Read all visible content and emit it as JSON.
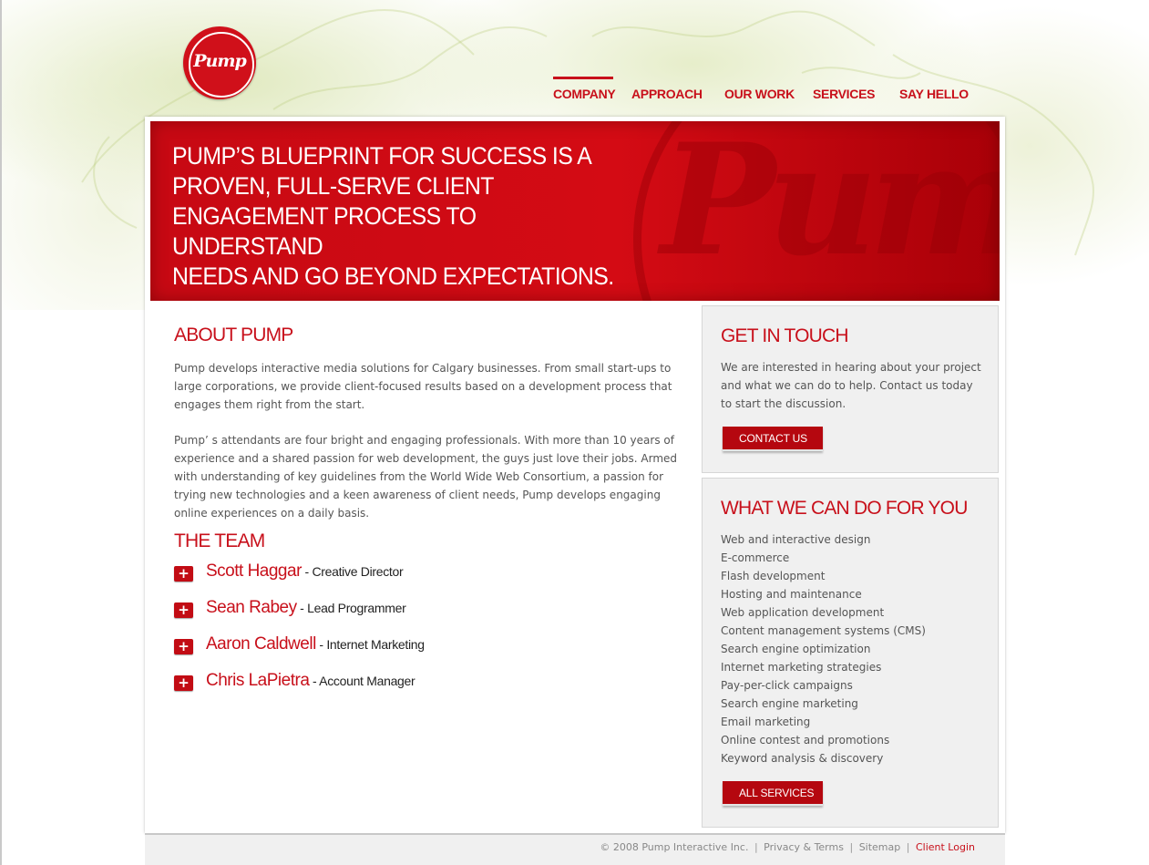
{
  "logo": {
    "text": "Pump"
  },
  "nav": {
    "items": [
      {
        "label": "COMPANY",
        "active": true
      },
      {
        "label": "APPROACH",
        "active": false
      },
      {
        "label": "OUR WORK",
        "active": false
      },
      {
        "label": "SERVICES",
        "active": false
      },
      {
        "label": "SAY HELLO",
        "active": false
      }
    ]
  },
  "hero": {
    "line1": "PUMP’S BLUEPRINT FOR SUCCESS IS A",
    "line2": "PROVEN, FULL-SERVE CLIENT",
    "line3": "ENGAGEMENT PROCESS TO UNDERSTAND",
    "line4": "NEEDS AND GO BEYOND EXPECTATIONS.",
    "watermark": "Pump"
  },
  "about": {
    "title": "ABOUT PUMP",
    "paragraph1": "Pump develops interactive media solutions for Calgary businesses. From small start-ups to large corporations, we provide client-focused results based on a development process that engages them right from the start.",
    "paragraph2": "Pump’ s attendants are four bright and engaging professionals. With more than 10 years of experience and a shared passion for web development, the guys just love their jobs. Armed with understanding of key guidelines from the World Wide Web Consortium, a passion for trying new technologies and a keen awareness of client needs, Pump develops engaging online experiences on a daily basis."
  },
  "team": {
    "title": "THE TEAM",
    "members": [
      {
        "name": "Scott Haggar",
        "role": " - Creative Director"
      },
      {
        "name": "Sean Rabey",
        "role": " - Lead Programmer"
      },
      {
        "name": "Aaron Caldwell",
        "role": " - Internet Marketing"
      },
      {
        "name": "Chris LaPietra",
        "role": " - Account Manager"
      }
    ]
  },
  "touch": {
    "title": "GET IN TOUCH",
    "text": "We are interested in hearing about your project and what we can do to help. Contact us today to start the discussion.",
    "button": "CONTACT US"
  },
  "services": {
    "title": "WHAT WE CAN DO FOR YOU",
    "items": [
      "Web and interactive design",
      "E-commerce",
      "Flash development",
      "Hosting and maintenance",
      "Web application development",
      "Content management systems (CMS)",
      "Search engine optimization",
      "Internet marketing strategies",
      "Pay-per-click campaigns",
      "Search engine marketing",
      "Email marketing",
      "Online contest and promotions",
      "Keyword analysis & discovery"
    ],
    "button": "ALL SERVICES"
  },
  "footer": {
    "copyright": "© 2008 Pump Interactive Inc.",
    "privacy": "Privacy & Terms",
    "sitemap": "Sitemap",
    "login": "Client Login",
    "separator": "|"
  },
  "colors": {
    "brand_red": "#c8101b",
    "panel_gray": "#f0f0f0"
  }
}
